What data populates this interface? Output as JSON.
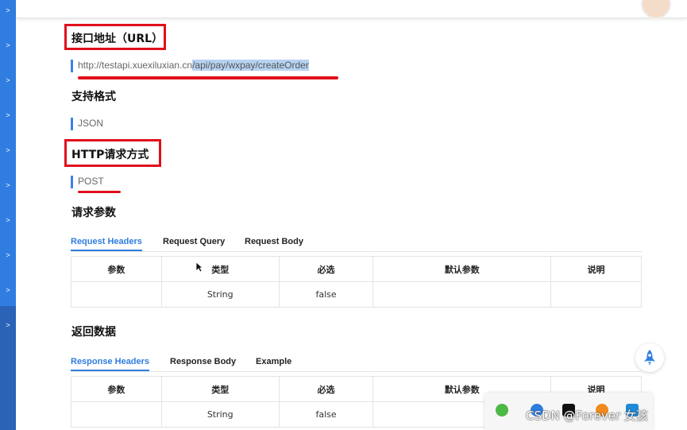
{
  "sections": {
    "url": {
      "heading": "接口地址（URL）",
      "value_prefix": "http://testapi.xuexiluxian.cn",
      "value_path": "/api/pay/wxpay/createOrder"
    },
    "format": {
      "heading": "支持格式",
      "value": "JSON"
    },
    "method": {
      "heading": "HTTP请求方式",
      "value": "POST"
    },
    "request": {
      "heading": "请求参数",
      "tabs": [
        "Request Headers",
        "Request Query",
        "Request Body"
      ],
      "active_tab": 0
    },
    "response": {
      "heading": "返回数据",
      "tabs": [
        "Response Headers",
        "Response Body",
        "Example"
      ],
      "active_tab": 0
    }
  },
  "table": {
    "columns": [
      "参数",
      "类型",
      "必选",
      "默认参数",
      "说明"
    ],
    "request_row": [
      "",
      "String",
      "false",
      "",
      ""
    ],
    "response_row": [
      "",
      "String",
      "false",
      "",
      ""
    ]
  },
  "watermark": "CSDN @Forever  女孩",
  "colors": {
    "accent": "#2f7de0",
    "annotation": "#e0101c",
    "sidebar": "#2f7de0"
  },
  "icons": {
    "rocket": "rocket-icon",
    "cursor": "mouse-cursor-icon"
  }
}
